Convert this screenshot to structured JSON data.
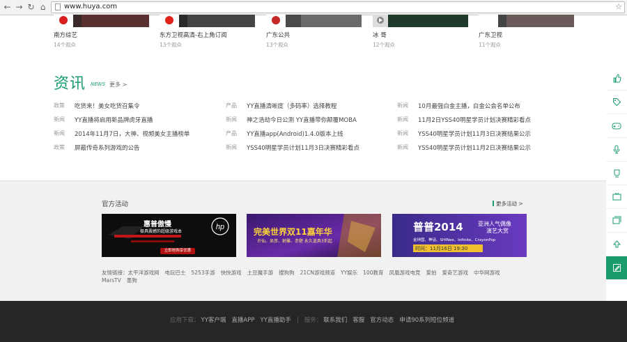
{
  "browser": {
    "url": "www.huya.com"
  },
  "videos": [
    {
      "caption": "南方综艺",
      "count": "14个观众",
      "badge": "南方"
    },
    {
      "caption": "东方卫视高清-右上角订阅",
      "count": "13个观众",
      "badge": "东方"
    },
    {
      "caption": "广东公共",
      "count": "13个观众",
      "badge": "广东公共"
    },
    {
      "caption": "冰  哥",
      "count": "12个观众",
      "badge": ""
    },
    {
      "caption": "广东卫视",
      "count": "11个观众",
      "badge": "广东卫视"
    }
  ],
  "news": {
    "title": "资讯",
    "title_en": "NEWS",
    "more": "更多 >",
    "columns": [
      [
        {
          "tag": "政策",
          "text": "吃货来！美女吃货召集令"
        },
        {
          "tag": "新闻",
          "text": "YY直播将启用新品牌虎牙直播"
        },
        {
          "tag": "新闻",
          "text": "2014年11月7日，大神、视频美女主播榜单"
        },
        {
          "tag": "政策",
          "text": "屏蔽传奇系列游戏的公告"
        }
      ],
      [
        {
          "tag": "产品",
          "text": "YY直播清晰度（多码率）选择教程"
        },
        {
          "tag": "新闻",
          "text": "神之浩劫今日公测 YY直播带你颠覆MOBA"
        },
        {
          "tag": "产品",
          "text": "YY直播app(Android)1.4.0版本上线"
        },
        {
          "tag": "新闻",
          "text": "YSS40明星学员计划11月3日决赛精彩看点"
        }
      ],
      [
        {
          "tag": "新闻",
          "text": "10月最强白金主播，白金公会名单公布"
        },
        {
          "tag": "新闻",
          "text": "11月2日YSS40明星学员计划决赛精彩看点"
        },
        {
          "tag": "新闻",
          "text": "YSS40明星学员计划11月3日决赛结果公示"
        },
        {
          "tag": "新闻",
          "text": "YSS40明星学员计划11月2日决赛结果公示"
        }
      ]
    ]
  },
  "activities": {
    "title": "官方活动",
    "more": "更多活动 >",
    "banners": [
      {
        "headline": "惠普傲慢",
        "sub": "极具震撼的超级游戏本",
        "cta": "立即抢购享优惠",
        "brand": "hp"
      },
      {
        "headline": "完美世界双11嘉年华",
        "sub": "许仙、吴彦、射雕、赤壁 永久道具3折起"
      },
      {
        "headline": "普普2014",
        "sub1": "亚洲人气偶像",
        "sub2": "演艺大赏",
        "artists": "金钟国、神话、SHINee、Infinite、CrayonPop",
        "time": "时间：11月16日 19:30"
      }
    ]
  },
  "friend_links": {
    "label": "友情链接：",
    "items": [
      "太平洋游戏网",
      "电玩巴士",
      "5253手游",
      "快快游戏",
      "土豆魔手游",
      "搜狗狗",
      "21CN游戏频道",
      "YY娱乐",
      "100教育",
      "凤凰游戏电竞",
      "爱拍",
      "爱奇艺游戏",
      "中华网游戏",
      "MarsTV",
      "墨狗"
    ]
  },
  "footer": {
    "download_label": "应用下载：",
    "downloads": [
      "YY客户端",
      "直播APP",
      "YY直播助手"
    ],
    "service_label": "服务：",
    "services": [
      "联系我们",
      "客服",
      "官方动态",
      "申请90系列短位频道"
    ]
  },
  "sidebar": [
    "thumbs-up-icon",
    "tag-icon",
    "gamepad-icon",
    "microphone-icon",
    "cup-icon",
    "tv-icon",
    "cards-icon",
    "arrow-up-icon",
    "edit-icon"
  ],
  "colors": {
    "accent": "#1a9c6d",
    "footer_bg": "#262626"
  }
}
